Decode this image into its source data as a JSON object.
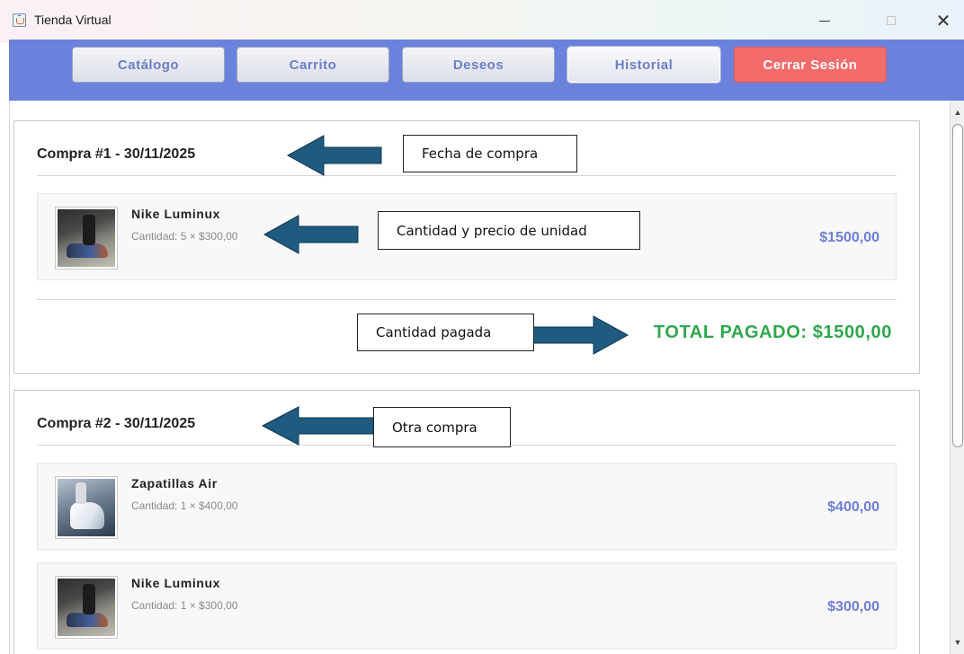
{
  "window": {
    "title": "Tienda Virtual",
    "minimize_icon": "minimize-icon",
    "maximize_icon": "maximize-icon",
    "close_glyph": "✕"
  },
  "nav": {
    "catalog": "Catálogo",
    "cart": "Carrito",
    "wishlist": "Deseos",
    "history": "Historial",
    "logout": "Cerrar Sesión",
    "active": "history"
  },
  "colors": {
    "navbar": "#6b82dd",
    "logout": "#f46b6b",
    "price": "#6b7ed9",
    "total": "#2fa84f",
    "annotation_arrow": "#1f5b7f"
  },
  "purchases": [
    {
      "title": "Compra #1 - 30/11/2025",
      "items": [
        {
          "name": "Nike Luminux",
          "quantity_line": "Cantidad: 5 × $300,00",
          "subtotal": "$1500,00",
          "image": "nike-luminux-photo"
        }
      ],
      "total": "TOTAL PAGADO: $1500,00"
    },
    {
      "title": "Compra #2 - 30/11/2025",
      "items": [
        {
          "name": "Zapatillas Air",
          "quantity_line": "Cantidad: 1 × $400,00",
          "subtotal": "$400,00",
          "image": "zapatillas-air-photo"
        },
        {
          "name": "Nike Luminux",
          "quantity_line": "Cantidad: 1 × $300,00",
          "subtotal": "$300,00",
          "image": "nike-luminux-photo"
        }
      ]
    }
  ],
  "annotations": {
    "purchase_date": "Fecha de compra",
    "unit_quantity_price": "Cantidad y precio de unidad",
    "amount_paid": "Cantidad pagada",
    "another_purchase": "Otra compra"
  }
}
